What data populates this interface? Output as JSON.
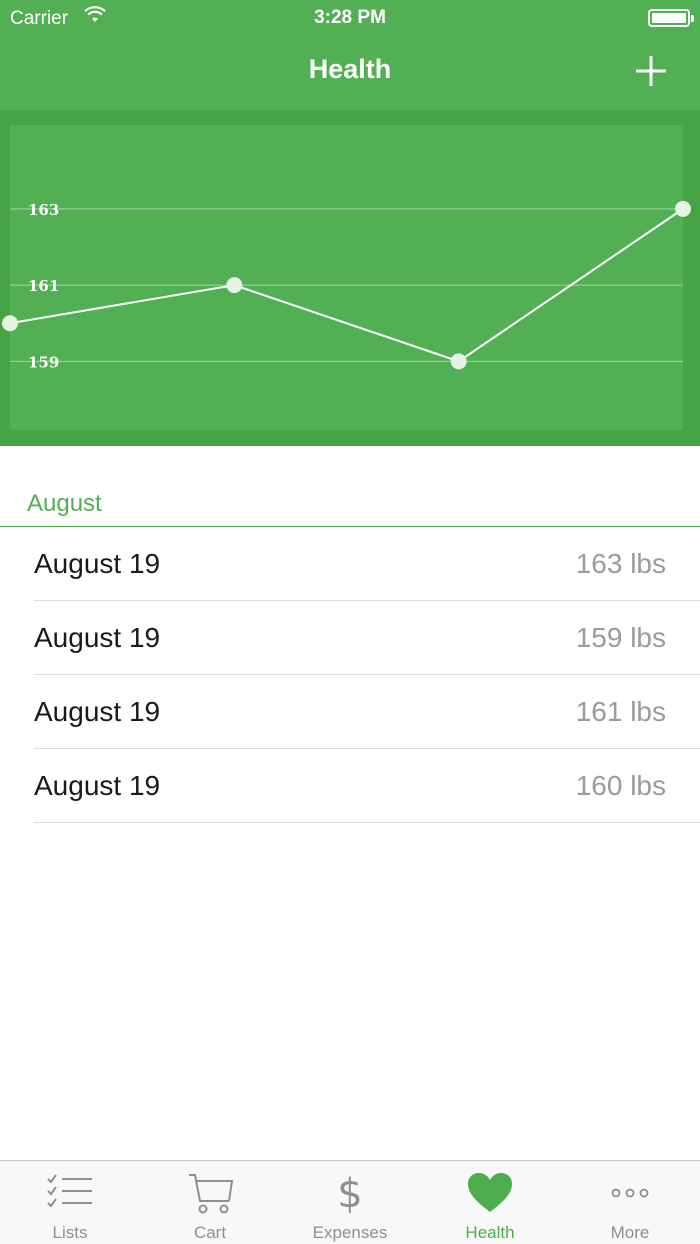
{
  "status_bar": {
    "carrier": "Carrier",
    "time": "3:28 PM"
  },
  "nav": {
    "title": "Health",
    "add_icon": "plus-icon"
  },
  "chart_data": {
    "type": "line",
    "y_ticks": [
      "163",
      "161",
      "159"
    ],
    "points": [
      160,
      161,
      159,
      163
    ],
    "ylim": [
      157.2,
      165.2
    ],
    "grid": true,
    "colors": {
      "line": "#ffffff",
      "background": "#53af53",
      "frame": "#46a346"
    }
  },
  "section": {
    "title": "August"
  },
  "entries": [
    {
      "date": "August 19",
      "weight": "163 lbs"
    },
    {
      "date": "August 19",
      "weight": "159 lbs"
    },
    {
      "date": "August 19",
      "weight": "161 lbs"
    },
    {
      "date": "August 19",
      "weight": "160 lbs"
    }
  ],
  "tabs": [
    {
      "label": "Lists",
      "icon": "checklist-icon",
      "active": false
    },
    {
      "label": "Cart",
      "icon": "cart-icon",
      "active": false
    },
    {
      "label": "Expenses",
      "icon": "dollar-icon",
      "active": false
    },
    {
      "label": "Health",
      "icon": "heart-icon",
      "active": true
    },
    {
      "label": "More",
      "icon": "more-dots-icon",
      "active": false
    }
  ],
  "colors": {
    "accent": "#53af53",
    "accent_dark": "#46a346",
    "inactive": "#8e8e93"
  }
}
